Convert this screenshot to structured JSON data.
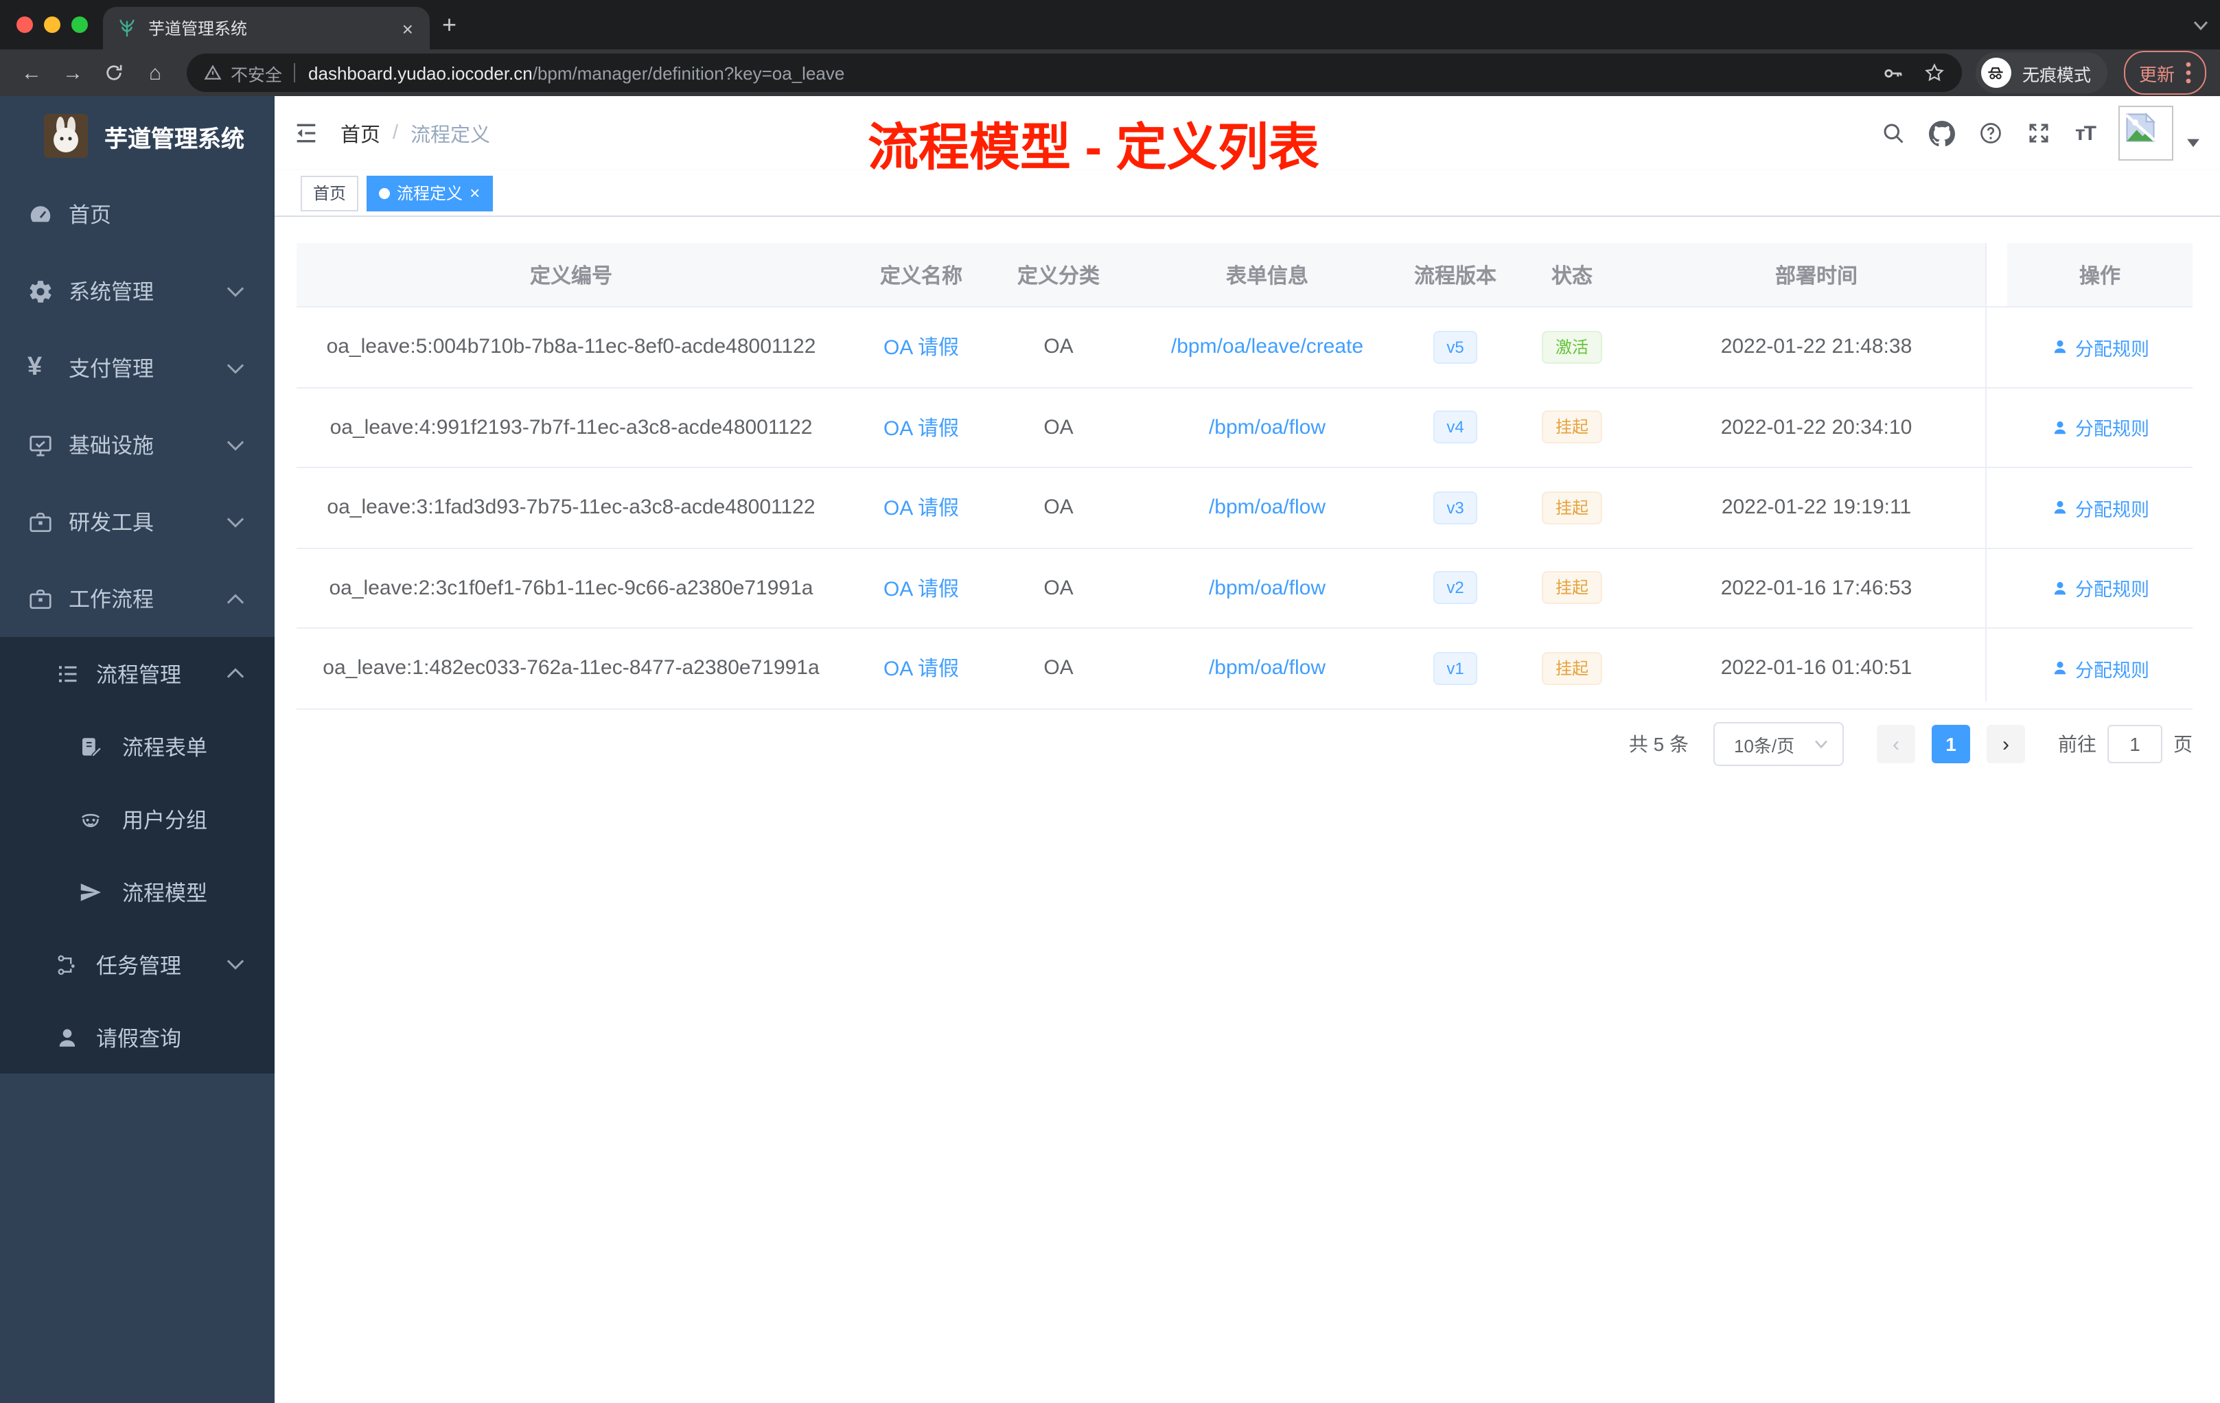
{
  "colors": {
    "accent": "#409eff",
    "success": "#67c23a",
    "warning": "#e6a23c",
    "annotation_red": "#ff2000",
    "sidebar_bg": "#304156",
    "submenu_bg": "#1f2d3d"
  },
  "browser": {
    "tab_title": "芋道管理系统",
    "tab_close": "×",
    "new_tab": "+",
    "back": "←",
    "forward": "→",
    "home": "⌂",
    "not_secure": "不安全",
    "url_host": "dashboard.yudao.iocoder.cn",
    "url_path": "/bpm/manager/definition?key=oa_leave",
    "incognito_label": "无痕模式",
    "update_label": "更新"
  },
  "sidebar": {
    "title": "芋道管理系统",
    "items": [
      {
        "label": "首页"
      },
      {
        "label": "系统管理"
      },
      {
        "label": "支付管理"
      },
      {
        "label": "基础设施"
      },
      {
        "label": "研发工具"
      },
      {
        "label": "工作流程"
      }
    ],
    "submenu": {
      "label": "流程管理",
      "children": [
        {
          "label": "流程表单"
        },
        {
          "label": "用户分组"
        },
        {
          "label": "流程模型"
        }
      ]
    },
    "extra": [
      {
        "label": "任务管理"
      },
      {
        "label": "请假查询"
      }
    ]
  },
  "navbar": {
    "breadcrumb_home": "首页",
    "breadcrumb_sep": "/",
    "breadcrumb_current": "流程定义",
    "annotation": "流程模型 - 定义列表"
  },
  "tags": {
    "home": "首页",
    "active": "流程定义",
    "close": "×"
  },
  "table": {
    "headers": {
      "id": "定义编号",
      "name": "定义名称",
      "category": "定义分类",
      "form": "表单信息",
      "version": "流程版本",
      "status": "状态",
      "time": "部署时间",
      "actions": "操作"
    },
    "rows": [
      {
        "id": "oa_leave:5:004b710b-7b8a-11ec-8ef0-acde48001122",
        "name": "OA 请假",
        "category": "OA",
        "form": "/bpm/oa/leave/create",
        "version": "v5",
        "status": "激活",
        "status_type": "success",
        "time": "2022-01-22 21:48:38",
        "action": "分配规则"
      },
      {
        "id": "oa_leave:4:991f2193-7b7f-11ec-a3c8-acde48001122",
        "name": "OA 请假",
        "category": "OA",
        "form": "/bpm/oa/flow",
        "version": "v4",
        "status": "挂起",
        "status_type": "warning",
        "time": "2022-01-22 20:34:10",
        "action": "分配规则"
      },
      {
        "id": "oa_leave:3:1fad3d93-7b75-11ec-a3c8-acde48001122",
        "name": "OA 请假",
        "category": "OA",
        "form": "/bpm/oa/flow",
        "version": "v3",
        "status": "挂起",
        "status_type": "warning",
        "time": "2022-01-22 19:19:11",
        "action": "分配规则"
      },
      {
        "id": "oa_leave:2:3c1f0ef1-76b1-11ec-9c66-a2380e71991a",
        "name": "OA 请假",
        "category": "OA",
        "form": "/bpm/oa/flow",
        "version": "v2",
        "status": "挂起",
        "status_type": "warning",
        "time": "2022-01-16 17:46:53",
        "action": "分配规则"
      },
      {
        "id": "oa_leave:1:482ec033-762a-11ec-8477-a2380e71991a",
        "name": "OA 请假",
        "category": "OA",
        "form": "/bpm/oa/flow",
        "version": "v1",
        "status": "挂起",
        "status_type": "warning",
        "time": "2022-01-16 01:40:51",
        "action": "分配规则"
      }
    ]
  },
  "pagination": {
    "total": "共 5 条",
    "page_size": "10条/页",
    "prev": "‹",
    "page": "1",
    "next": "›",
    "goto_label": "前往",
    "goto_value": "1",
    "goto_suffix": "页"
  }
}
